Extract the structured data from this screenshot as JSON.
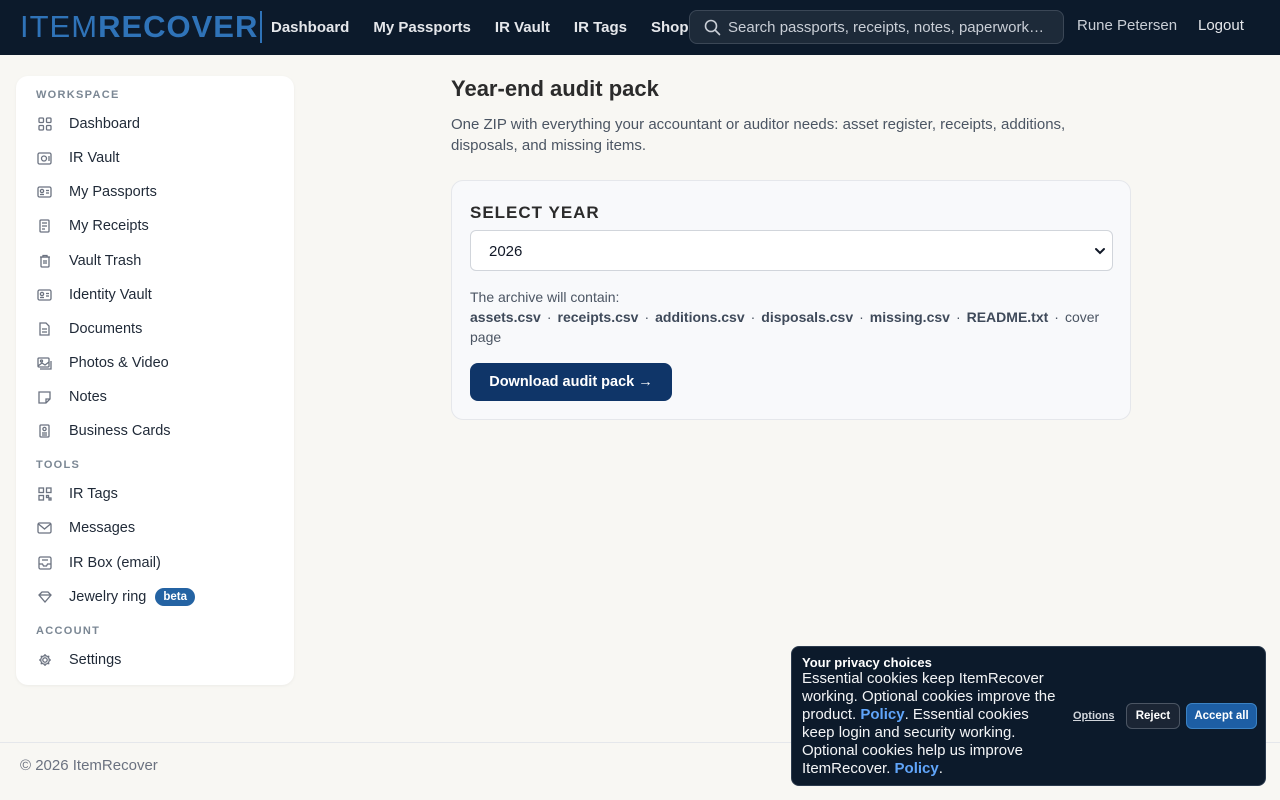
{
  "header": {
    "logo_part1": "ITEM",
    "logo_part2": "RECOVER",
    "nav": [
      "Dashboard",
      "My Passports",
      "IR Vault",
      "IR Tags",
      "Shop"
    ],
    "search_placeholder": "Search passports, receipts, notes, paperwork…",
    "user_name": "Rune Petersen",
    "logout_label": "Logout"
  },
  "sidebar": {
    "workspace_label": "WORKSPACE",
    "workspace_items": [
      {
        "label": "Dashboard",
        "icon": "grid-icon"
      },
      {
        "label": "IR Vault",
        "icon": "vault-icon"
      },
      {
        "label": "My Passports",
        "icon": "id-card-icon"
      },
      {
        "label": "My Receipts",
        "icon": "receipt-icon"
      },
      {
        "label": "Vault Trash",
        "icon": "trash-icon"
      },
      {
        "label": "Identity Vault",
        "icon": "id-card-icon"
      },
      {
        "label": "Documents",
        "icon": "document-icon"
      },
      {
        "label": "Photos & Video",
        "icon": "photos-icon"
      },
      {
        "label": "Notes",
        "icon": "note-icon"
      },
      {
        "label": "Business Cards",
        "icon": "business-card-icon"
      }
    ],
    "tools_label": "TOOLS",
    "tools_items": [
      {
        "label": "IR Tags",
        "icon": "qr-icon"
      },
      {
        "label": "Messages",
        "icon": "mail-icon"
      },
      {
        "label": "IR Box (email)",
        "icon": "inbox-icon"
      },
      {
        "label": "Jewelry ring",
        "icon": "diamond-icon",
        "badge": "beta"
      }
    ],
    "account_label": "ACCOUNT",
    "account_items": [
      {
        "label": "Settings",
        "icon": "gear-icon"
      }
    ]
  },
  "main": {
    "title": "Year-end audit pack",
    "description": "One ZIP with everything your accountant or auditor needs: asset register, receipts, additions, disposals, and missing items.",
    "select_label": "SELECT YEAR",
    "selected_year": "2026",
    "contains_intro": "The archive will contain:",
    "files": [
      "assets.csv",
      "receipts.csv",
      "additions.csv",
      "disposals.csv",
      "missing.csv",
      "README.txt"
    ],
    "contains_tail": "cover page",
    "download_label": "Download audit pack →"
  },
  "footer": {
    "copyright": "© 2026 ItemRecover"
  },
  "cookie": {
    "title": "Your privacy choices",
    "text_1": "Essential cookies keep ItemRecover working. Optional cookies improve the product. ",
    "link_1": "Policy",
    "text_2": ". Essential cookies keep login and security working. Optional cookies help us improve ItemRecover. ",
    "link_2": "Policy",
    "text_3": ".",
    "options_label": "Options",
    "reject_label": "Reject",
    "accept_label": "Accept all"
  },
  "colors": {
    "topbar": "#0c1a2b",
    "brand": "#2f73b8",
    "primary_button": "#0f3568",
    "accept_button": "#1d5ea4",
    "link": "#60a5fa"
  }
}
